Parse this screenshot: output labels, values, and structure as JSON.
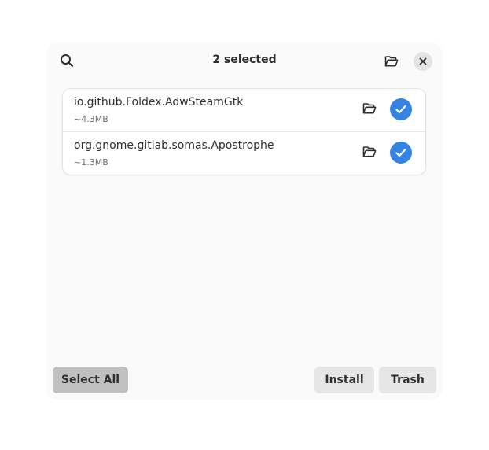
{
  "colors": {
    "accent": "#3584e4",
    "window_bg": "#fafafa",
    "card_bg": "#ffffff",
    "button_bg": "#e6e6e6",
    "button_active_bg": "#c0c0c0"
  },
  "header": {
    "title": "2 selected",
    "search_icon": "search-icon",
    "open_folder_icon": "folder-open-icon",
    "close_icon": "close-icon"
  },
  "apps": [
    {
      "name": "io.github.Foldex.AdwSteamGtk",
      "size": "~4.3MB",
      "selected": true,
      "folder_icon": "folder-open-icon",
      "check_icon": "checkmark-icon"
    },
    {
      "name": "org.gnome.gitlab.somas.Apostrophe",
      "size": "~1.3MB",
      "selected": true,
      "folder_icon": "folder-open-icon",
      "check_icon": "checkmark-icon"
    }
  ],
  "footer": {
    "select_all_label": "Select All",
    "install_label": "Install",
    "trash_label": "Trash"
  }
}
